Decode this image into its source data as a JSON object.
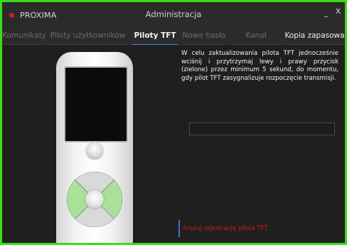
{
  "window": {
    "app_name": "PROXIMA",
    "title": "Administracja",
    "minimize_label": "_",
    "close_label": "x",
    "border_color": "#37e016"
  },
  "tabs": [
    {
      "label": "Komunikaty",
      "active": false
    },
    {
      "label": "Piloty użytkowników",
      "active": false
    },
    {
      "label": "Piloty TFT",
      "active": true
    },
    {
      "label": "Nowe hasło",
      "active": false
    },
    {
      "label": "Kanał systemu",
      "active": false
    },
    {
      "label": "Kopia zapasowa",
      "active": false
    }
  ],
  "main": {
    "instruction": "W celu zaktualizowania pilota TFT jednocześnie wciśnij i przytrzymaj lewy i prawy przycisk (zielone) przez minimum 5 sekund, do momentu, gdy pilot TFT zasygnalizuje rozpoczęcie transmisji.",
    "progress": 0,
    "cancel_link": "Anuluj rejestrację pilota TFT"
  },
  "remote": {
    "highlight_color": "#a8e29a"
  },
  "icons": {
    "brand": "brand-dot-icon",
    "remote": "remote-control-icon"
  }
}
